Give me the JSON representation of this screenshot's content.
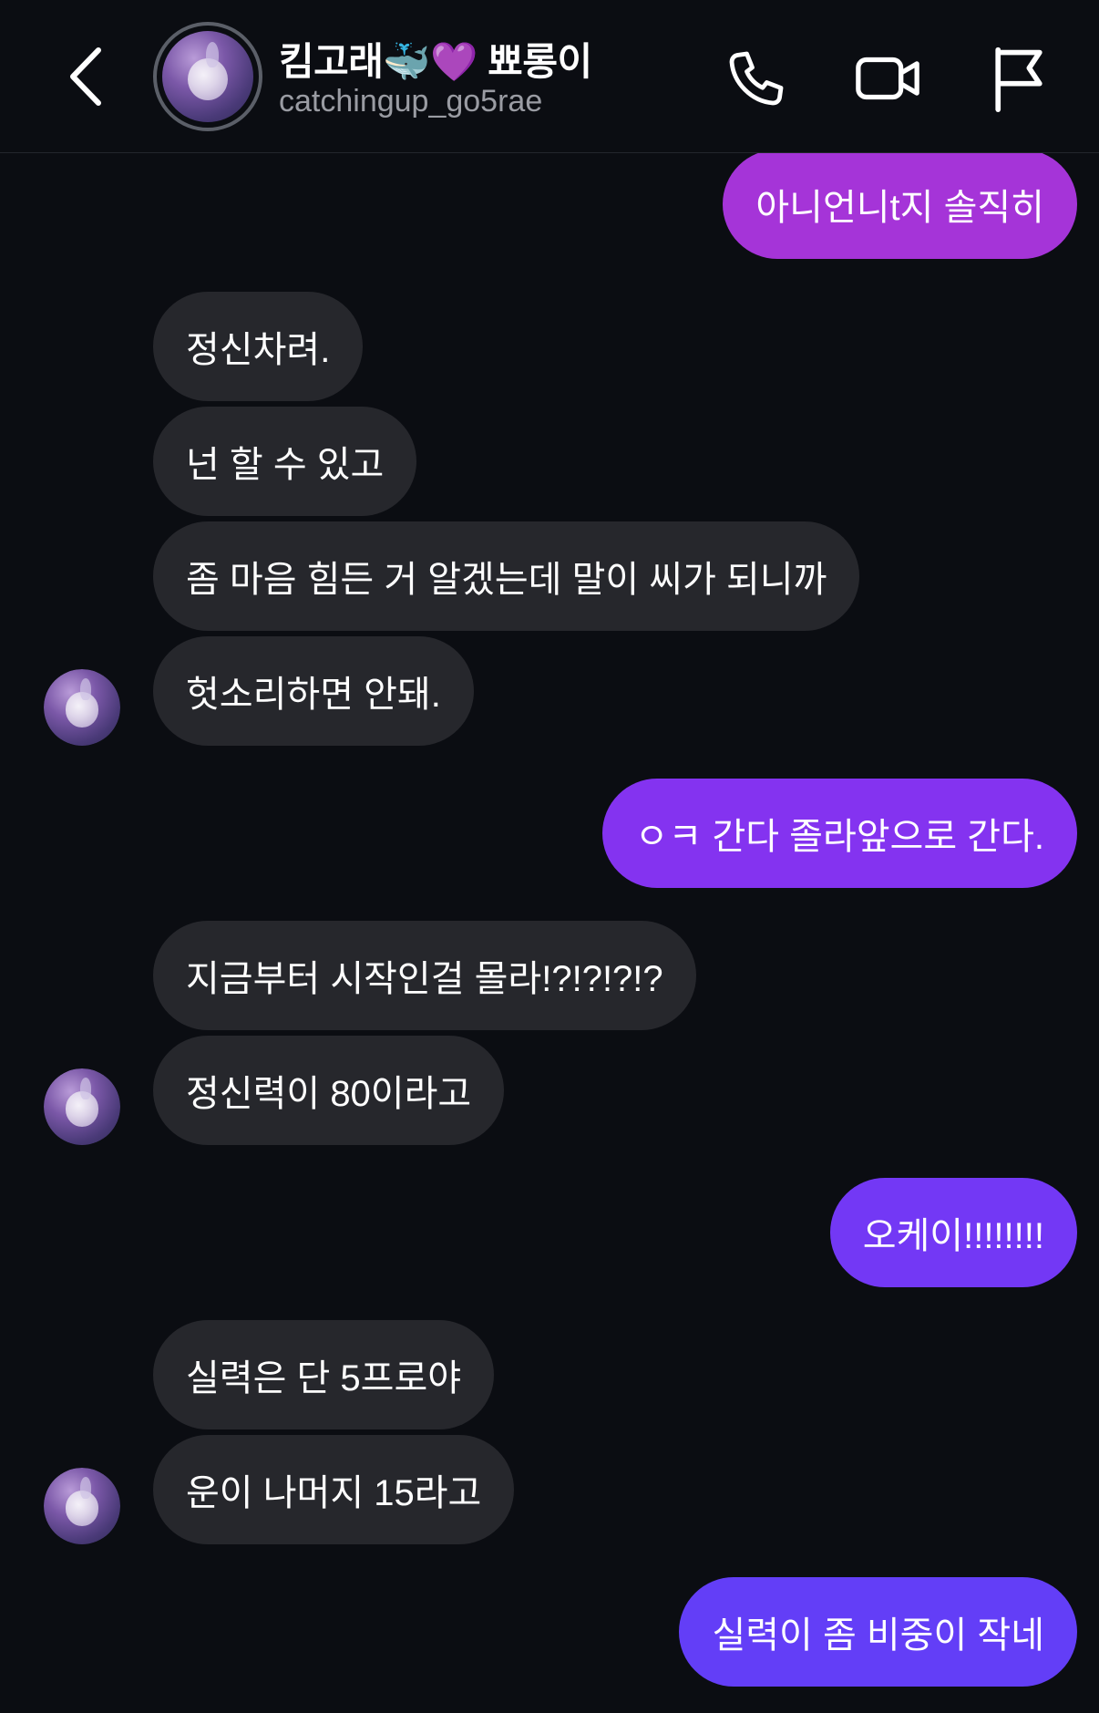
{
  "header": {
    "name": "킴고래🐳💜 뾰롱이",
    "handle": "catchingup_go5rae"
  },
  "icons": {
    "back": "chevron-left-icon",
    "call": "phone-icon",
    "video": "video-camera-icon",
    "report": "flag-icon"
  },
  "colors": {
    "background": "#0b0d12",
    "incoming_bubble": "#26272c",
    "outgoing_1": "#a534d8",
    "outgoing_2": "#8433f0",
    "outgoing_3": "#7338f5",
    "outgoing_4": "#633ef7"
  },
  "messages": [
    {
      "sender": "me",
      "text": "아니언니t지 솔직히"
    },
    {
      "sender": "them",
      "text": "정신차려."
    },
    {
      "sender": "them",
      "text": "넌 할 수 있고"
    },
    {
      "sender": "them",
      "text": "좀 마음 힘든 거 알겠는데 말이 씨가 되니까"
    },
    {
      "sender": "them",
      "text": "헛소리하면 안돼."
    },
    {
      "sender": "me",
      "text": "ㅇㅋ 간다 졸라앞으로 간다."
    },
    {
      "sender": "them",
      "text": "지금부터 시작인걸 몰라!?!?!?!?"
    },
    {
      "sender": "them",
      "text": "정신력이 80이라고"
    },
    {
      "sender": "me",
      "text": "오케이!!!!!!!!"
    },
    {
      "sender": "them",
      "text": "실력은 단 5프로야"
    },
    {
      "sender": "them",
      "text": "운이 나머지 15라고"
    },
    {
      "sender": "me",
      "text": "실력이 좀 비중이 작네"
    }
  ]
}
